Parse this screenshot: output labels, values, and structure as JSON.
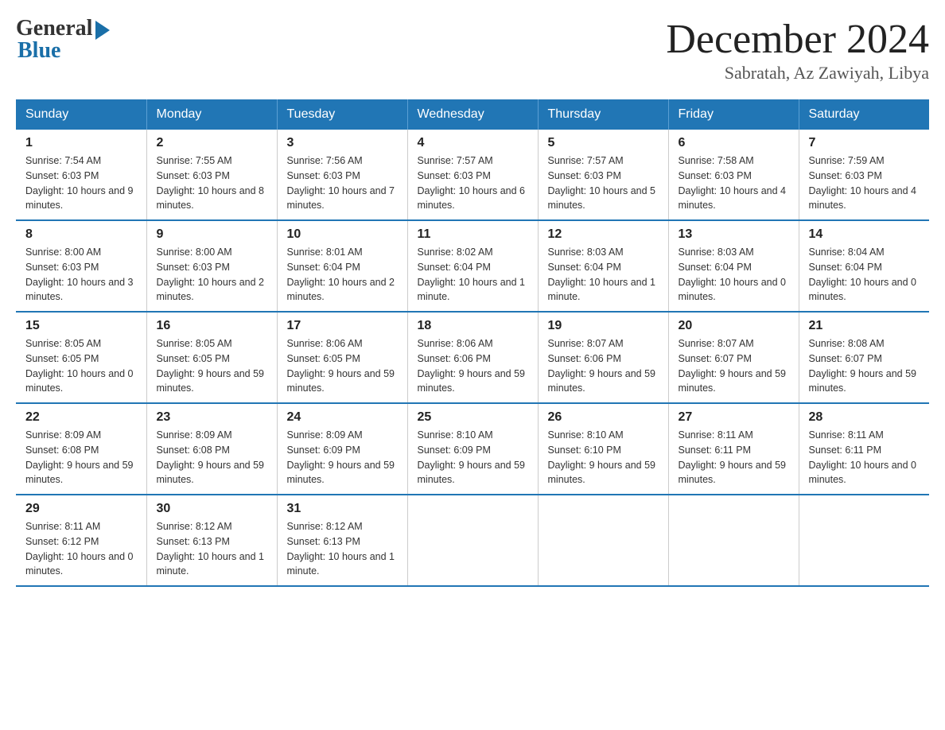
{
  "logo": {
    "general": "General",
    "blue": "Blue"
  },
  "title": {
    "month": "December 2024",
    "location": "Sabratah, Az Zawiyah, Libya"
  },
  "headers": [
    "Sunday",
    "Monday",
    "Tuesday",
    "Wednesday",
    "Thursday",
    "Friday",
    "Saturday"
  ],
  "weeks": [
    [
      {
        "day": "1",
        "sunrise": "7:54 AM",
        "sunset": "6:03 PM",
        "daylight": "10 hours and 9 minutes."
      },
      {
        "day": "2",
        "sunrise": "7:55 AM",
        "sunset": "6:03 PM",
        "daylight": "10 hours and 8 minutes."
      },
      {
        "day": "3",
        "sunrise": "7:56 AM",
        "sunset": "6:03 PM",
        "daylight": "10 hours and 7 minutes."
      },
      {
        "day": "4",
        "sunrise": "7:57 AM",
        "sunset": "6:03 PM",
        "daylight": "10 hours and 6 minutes."
      },
      {
        "day": "5",
        "sunrise": "7:57 AM",
        "sunset": "6:03 PM",
        "daylight": "10 hours and 5 minutes."
      },
      {
        "day": "6",
        "sunrise": "7:58 AM",
        "sunset": "6:03 PM",
        "daylight": "10 hours and 4 minutes."
      },
      {
        "day": "7",
        "sunrise": "7:59 AM",
        "sunset": "6:03 PM",
        "daylight": "10 hours and 4 minutes."
      }
    ],
    [
      {
        "day": "8",
        "sunrise": "8:00 AM",
        "sunset": "6:03 PM",
        "daylight": "10 hours and 3 minutes."
      },
      {
        "day": "9",
        "sunrise": "8:00 AM",
        "sunset": "6:03 PM",
        "daylight": "10 hours and 2 minutes."
      },
      {
        "day": "10",
        "sunrise": "8:01 AM",
        "sunset": "6:04 PM",
        "daylight": "10 hours and 2 minutes."
      },
      {
        "day": "11",
        "sunrise": "8:02 AM",
        "sunset": "6:04 PM",
        "daylight": "10 hours and 1 minute."
      },
      {
        "day": "12",
        "sunrise": "8:03 AM",
        "sunset": "6:04 PM",
        "daylight": "10 hours and 1 minute."
      },
      {
        "day": "13",
        "sunrise": "8:03 AM",
        "sunset": "6:04 PM",
        "daylight": "10 hours and 0 minutes."
      },
      {
        "day": "14",
        "sunrise": "8:04 AM",
        "sunset": "6:04 PM",
        "daylight": "10 hours and 0 minutes."
      }
    ],
    [
      {
        "day": "15",
        "sunrise": "8:05 AM",
        "sunset": "6:05 PM",
        "daylight": "10 hours and 0 minutes."
      },
      {
        "day": "16",
        "sunrise": "8:05 AM",
        "sunset": "6:05 PM",
        "daylight": "9 hours and 59 minutes."
      },
      {
        "day": "17",
        "sunrise": "8:06 AM",
        "sunset": "6:05 PM",
        "daylight": "9 hours and 59 minutes."
      },
      {
        "day": "18",
        "sunrise": "8:06 AM",
        "sunset": "6:06 PM",
        "daylight": "9 hours and 59 minutes."
      },
      {
        "day": "19",
        "sunrise": "8:07 AM",
        "sunset": "6:06 PM",
        "daylight": "9 hours and 59 minutes."
      },
      {
        "day": "20",
        "sunrise": "8:07 AM",
        "sunset": "6:07 PM",
        "daylight": "9 hours and 59 minutes."
      },
      {
        "day": "21",
        "sunrise": "8:08 AM",
        "sunset": "6:07 PM",
        "daylight": "9 hours and 59 minutes."
      }
    ],
    [
      {
        "day": "22",
        "sunrise": "8:09 AM",
        "sunset": "6:08 PM",
        "daylight": "9 hours and 59 minutes."
      },
      {
        "day": "23",
        "sunrise": "8:09 AM",
        "sunset": "6:08 PM",
        "daylight": "9 hours and 59 minutes."
      },
      {
        "day": "24",
        "sunrise": "8:09 AM",
        "sunset": "6:09 PM",
        "daylight": "9 hours and 59 minutes."
      },
      {
        "day": "25",
        "sunrise": "8:10 AM",
        "sunset": "6:09 PM",
        "daylight": "9 hours and 59 minutes."
      },
      {
        "day": "26",
        "sunrise": "8:10 AM",
        "sunset": "6:10 PM",
        "daylight": "9 hours and 59 minutes."
      },
      {
        "day": "27",
        "sunrise": "8:11 AM",
        "sunset": "6:11 PM",
        "daylight": "9 hours and 59 minutes."
      },
      {
        "day": "28",
        "sunrise": "8:11 AM",
        "sunset": "6:11 PM",
        "daylight": "10 hours and 0 minutes."
      }
    ],
    [
      {
        "day": "29",
        "sunrise": "8:11 AM",
        "sunset": "6:12 PM",
        "daylight": "10 hours and 0 minutes."
      },
      {
        "day": "30",
        "sunrise": "8:12 AM",
        "sunset": "6:13 PM",
        "daylight": "10 hours and 1 minute."
      },
      {
        "day": "31",
        "sunrise": "8:12 AM",
        "sunset": "6:13 PM",
        "daylight": "10 hours and 1 minute."
      },
      null,
      null,
      null,
      null
    ]
  ]
}
